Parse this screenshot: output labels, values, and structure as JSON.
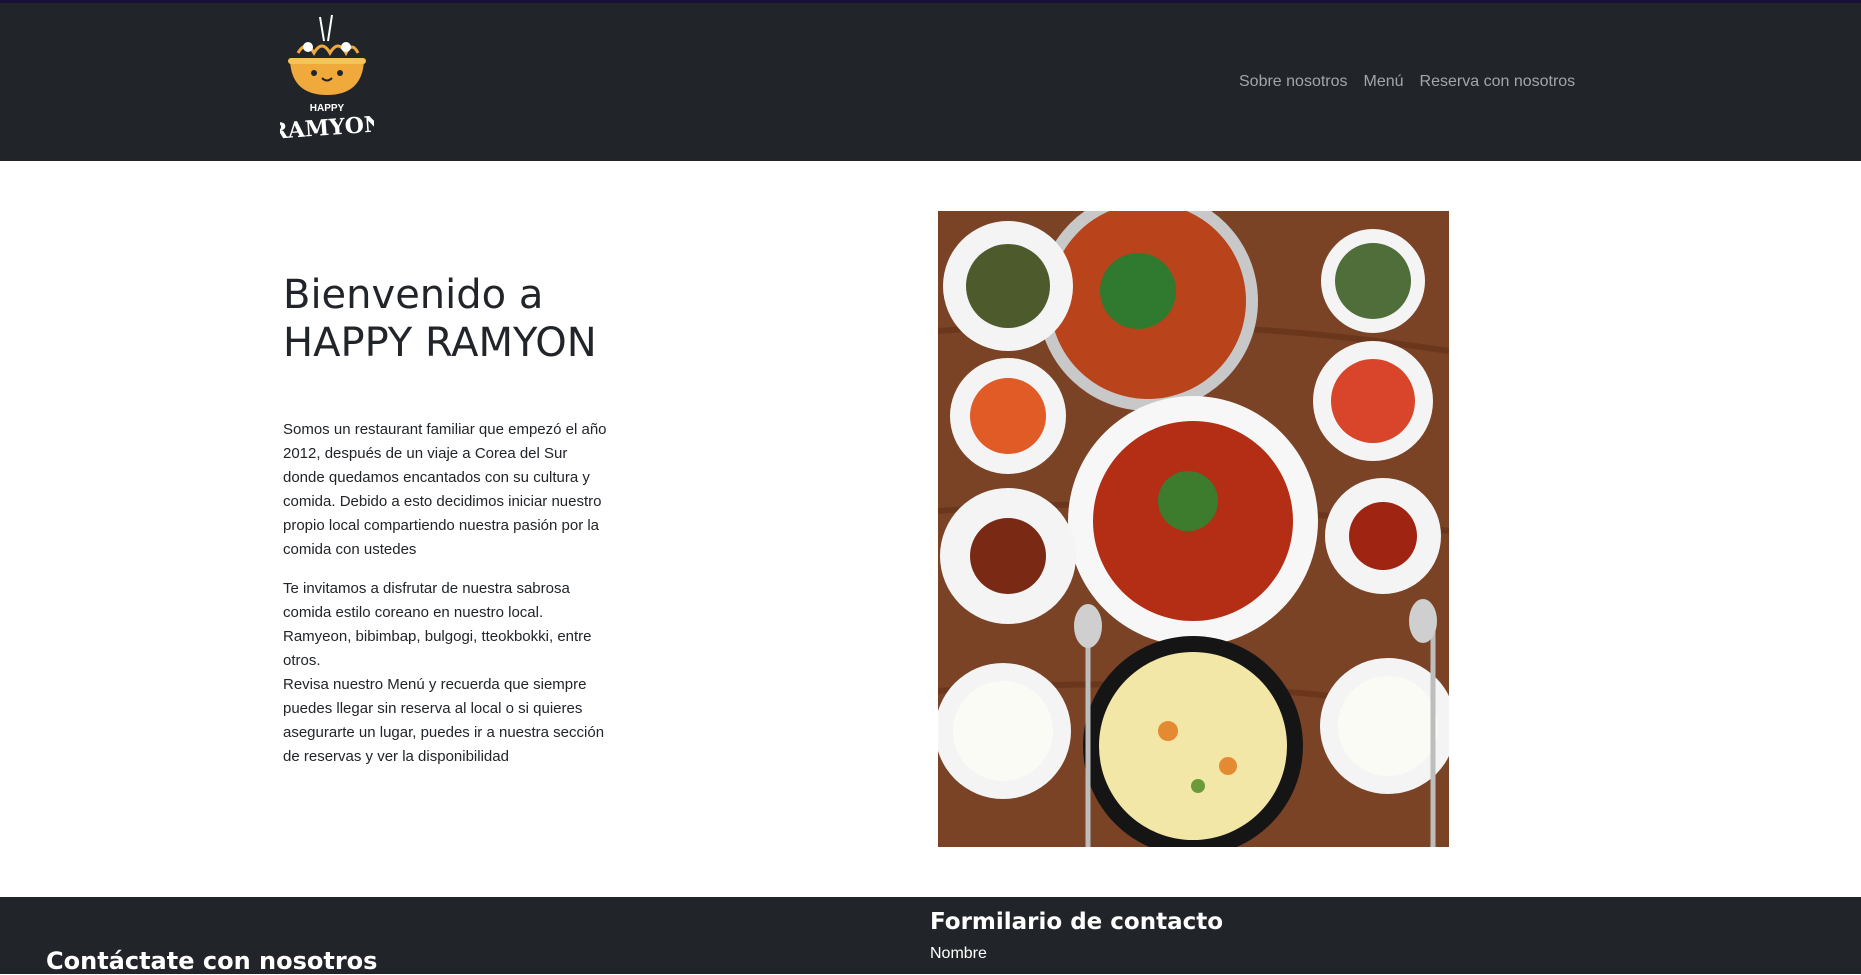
{
  "brand": {
    "logo_top_text": "HAPPY",
    "logo_main_text": "RAMYON"
  },
  "nav": {
    "links": [
      "Sobre nosotros",
      "Menú",
      "Reserva con nosotros"
    ]
  },
  "hero": {
    "title_line1": "Bienvenido a",
    "title_line2": "HAPPY RAMYON",
    "paragraph1": "Somos un restaurant familiar que empezó el año 2012, después de un viaje a Corea del Sur donde quedamos encantados con su cultura y comida. Debido a esto decidimos iniciar nuestro propio local compartiendo nuestra pasión por la comida con ustedes",
    "paragraph2": "Te invitamos a disfrutar de nuestra sabrosa comida estilo coreano en nuestro local. Ramyeon, bibimbap, bulgogi, tteokbokki, entre otros.",
    "paragraph3": "Revisa nuestro Menú y recuerda que siempre puedes llegar sin reserva al local o si quieres asegurarte un lugar, puedes ir a nuestra sección de reservas y ver la disponibilidad"
  },
  "footer": {
    "contact_title": "Contáctate con nosotros",
    "form_title": "Formilario de contacto",
    "name_label": "Nombre"
  },
  "colors": {
    "navbar_bg": "#212529",
    "nav_link": "#a3a6a9",
    "logo_orange": "#f0a93b"
  }
}
